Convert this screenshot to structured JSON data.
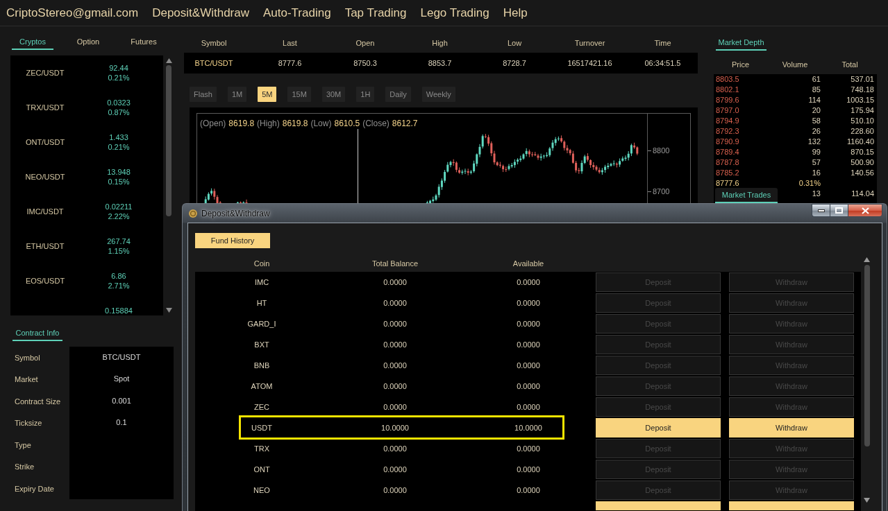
{
  "header": {
    "menu": [
      "CriptoStereo@gmail.com",
      "Deposit&Withdraw",
      "Auto-Trading",
      "Tap Trading",
      "Lego Trading",
      "Help"
    ]
  },
  "market_tabs": [
    {
      "label": "Cryptos",
      "selected": true
    },
    {
      "label": "Option",
      "selected": false
    },
    {
      "label": "Futures",
      "selected": false
    }
  ],
  "crypto_list": [
    {
      "pair": "ZEC/USDT",
      "price": "92.44",
      "change": "0.21%"
    },
    {
      "pair": "TRX/USDT",
      "price": "0.0323",
      "change": "0.87%"
    },
    {
      "pair": "ONT/USDT",
      "price": "1.433",
      "change": "0.21%"
    },
    {
      "pair": "NEO/USDT",
      "price": "13.948",
      "change": "0.15%"
    },
    {
      "pair": "IMC/USDT",
      "price": "0.02211",
      "change": "2.22%"
    },
    {
      "pair": "ETH/USDT",
      "price": "267.74",
      "change": "1.15%"
    },
    {
      "pair": "EOS/USDT",
      "price": "6.86",
      "change": "2.71%"
    },
    {
      "price": "0.15884"
    }
  ],
  "contract_info": {
    "tab": {
      "label": "Contract Info",
      "selected": true
    },
    "rows": [
      {
        "label": "Symbol",
        "value": "BTC/USDT"
      },
      {
        "label": "Market",
        "value": "Spot"
      },
      {
        "label": "Contract Size",
        "value": "0.001"
      },
      {
        "label": "Ticksize",
        "value": "0.1"
      },
      {
        "label": "Type"
      },
      {
        "label": "Strike"
      },
      {
        "label": "Expiry Date"
      }
    ]
  },
  "ticker": {
    "columns": [
      "Symbol",
      "Last",
      "Open",
      "High",
      "Low",
      "Turnover",
      "Time"
    ],
    "values": [
      "BTC/USDT",
      "8777.6",
      "8750.3",
      "8853.7",
      "8728.7",
      "16517421.16",
      "06:34:51.5"
    ]
  },
  "intervals": [
    {
      "label": "Flash",
      "selected": false
    },
    {
      "label": "1M",
      "selected": false
    },
    {
      "label": "5M",
      "selected": true
    },
    {
      "label": "15M",
      "selected": false
    },
    {
      "label": "30M",
      "selected": false
    },
    {
      "label": "1H",
      "selected": false
    },
    {
      "label": "Daily",
      "selected": false
    },
    {
      "label": "Weekly",
      "selected": false
    }
  ],
  "chart": {
    "readout": [
      {
        "label": "(Open)",
        "value": "8619.8"
      },
      {
        "label": "(High)",
        "value": "8619.8"
      },
      {
        "label": "(Low)",
        "value": "8610.5"
      },
      {
        "label": "(Close)",
        "value": "8612.7"
      }
    ],
    "axis_labels": [
      "8800",
      "8700"
    ]
  },
  "market_depth": {
    "tab": {
      "label": "Market Depth",
      "selected": true
    },
    "columns": [
      "Price",
      "Volume",
      "Total"
    ],
    "rows": [
      {
        "kind": "ask",
        "price": "8803.5",
        "volume": "61",
        "total": "537.01"
      },
      {
        "kind": "ask",
        "price": "8802.1",
        "volume": "85",
        "total": "748.18"
      },
      {
        "kind": "ask",
        "price": "8799.6",
        "volume": "114",
        "total": "1003.15"
      },
      {
        "kind": "ask",
        "price": "8797.0",
        "volume": "20",
        "total": "175.94"
      },
      {
        "kind": "ask",
        "price": "8794.9",
        "volume": "58",
        "total": "510.10"
      },
      {
        "kind": "ask",
        "price": "8792.3",
        "volume": "26",
        "total": "228.60"
      },
      {
        "kind": "ask",
        "price": "8790.9",
        "volume": "132",
        "total": "1160.40"
      },
      {
        "kind": "ask",
        "price": "8789.4",
        "volume": "99",
        "total": "870.15"
      },
      {
        "kind": "ask",
        "price": "8787.8",
        "volume": "57",
        "total": "500.90"
      },
      {
        "kind": "ask",
        "price": "8785.2",
        "volume": "16",
        "total": "140.56"
      },
      {
        "kind": "last",
        "price": "8777.6",
        "volume": "0.31%"
      },
      {
        "kind": "bid",
        "volume": "13",
        "total": "114.04"
      }
    ]
  },
  "market_trades_tab": {
    "label": "Market Trades",
    "selected": true
  },
  "dialog": {
    "title": "Deposit&Withdraw",
    "fund_history": "Fund History",
    "columns": [
      "Coin",
      "Total Balance",
      "Available"
    ],
    "rows": [
      {
        "coin": "IMC",
        "total_balance": "0.0000",
        "available": "0.0000",
        "deposit": "Deposit",
        "withdraw": "Withdraw",
        "enabled": false,
        "highlighted": false
      },
      {
        "coin": "HT",
        "total_balance": "0.0000",
        "available": "0.0000",
        "deposit": "Deposit",
        "withdraw": "Withdraw",
        "enabled": false,
        "highlighted": false
      },
      {
        "coin": "GARD_I",
        "total_balance": "0.0000",
        "available": "0.0000",
        "deposit": "Deposit",
        "withdraw": "Withdraw",
        "enabled": false,
        "highlighted": false
      },
      {
        "coin": "BXT",
        "total_balance": "0.0000",
        "available": "0.0000",
        "deposit": "Deposit",
        "withdraw": "Withdraw",
        "enabled": false,
        "highlighted": false
      },
      {
        "coin": "BNB",
        "total_balance": "0.0000",
        "available": "0.0000",
        "deposit": "Deposit",
        "withdraw": "Withdraw",
        "enabled": false,
        "highlighted": false
      },
      {
        "coin": "ATOM",
        "total_balance": "0.0000",
        "available": "0.0000",
        "deposit": "Deposit",
        "withdraw": "Withdraw",
        "enabled": false,
        "highlighted": false
      },
      {
        "coin": "ZEC",
        "total_balance": "0.0000",
        "available": "0.0000",
        "deposit": "Deposit",
        "withdraw": "Withdraw",
        "enabled": false,
        "highlighted": false
      },
      {
        "coin": "USDT",
        "total_balance": "10.0000",
        "available": "10.0000",
        "deposit": "Deposit",
        "withdraw": "Withdraw",
        "enabled": true,
        "highlighted": true
      },
      {
        "coin": "TRX",
        "total_balance": "0.0000",
        "available": "0.0000",
        "deposit": "Deposit",
        "withdraw": "Withdraw",
        "enabled": false,
        "highlighted": false
      },
      {
        "coin": "ONT",
        "total_balance": "0.0000",
        "available": "0.0000",
        "deposit": "Deposit",
        "withdraw": "Withdraw",
        "enabled": false,
        "highlighted": false
      },
      {
        "coin": "NEO",
        "total_balance": "0.0000",
        "available": "0.0000",
        "deposit": "Deposit",
        "withdraw": "Withdraw",
        "enabled": false,
        "highlighted": false
      },
      {
        "enabled": true,
        "highlighted": false
      }
    ]
  }
}
